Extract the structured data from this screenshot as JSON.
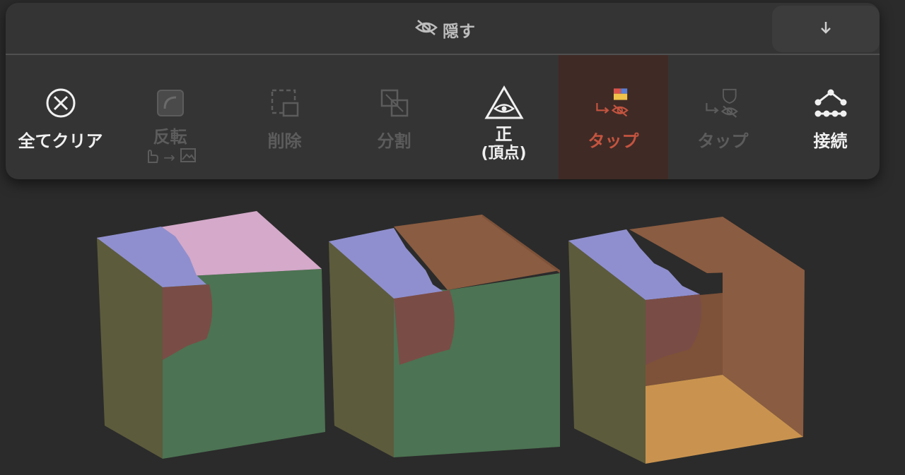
{
  "panel": {
    "title": "隠す",
    "title_icon": "hidden-eye-icon",
    "collapse_icon": "arrow-down-icon"
  },
  "tools": [
    {
      "id": "clear-all",
      "label": "全てクリア",
      "icon": "circle-x-icon",
      "state": "enabled"
    },
    {
      "id": "invert",
      "label": "反転",
      "sublabel": "→",
      "icon": "invert-icon",
      "state": "disabled"
    },
    {
      "id": "delete",
      "label": "削除",
      "icon": "delete-selection-icon",
      "state": "disabled"
    },
    {
      "id": "split",
      "label": "分割",
      "icon": "split-icon",
      "state": "disabled"
    },
    {
      "id": "positive",
      "label": "正",
      "sublabel": "(頂点)",
      "icon": "eye-pyramid-icon",
      "state": "enabled"
    },
    {
      "id": "tap-polygroup",
      "label": "タップ",
      "icon": "tap-hide-polygroup-icon",
      "state": "active"
    },
    {
      "id": "tap-mask",
      "label": "タップ",
      "icon": "tap-hide-mask-icon",
      "state": "disabled"
    },
    {
      "id": "connect",
      "label": "接続",
      "icon": "connect-icon",
      "state": "enabled"
    }
  ],
  "colors": {
    "panel": "#343434",
    "active_label": "#c4543f",
    "face_blue": "#8f8fcf",
    "face_pink": "#d4a9c9",
    "face_green": "#4c7353",
    "face_olive": "#5c5b3c",
    "face_brown": "#8a5c41",
    "face_maroon": "#7a4c46",
    "face_yellow": "#c9934f"
  }
}
